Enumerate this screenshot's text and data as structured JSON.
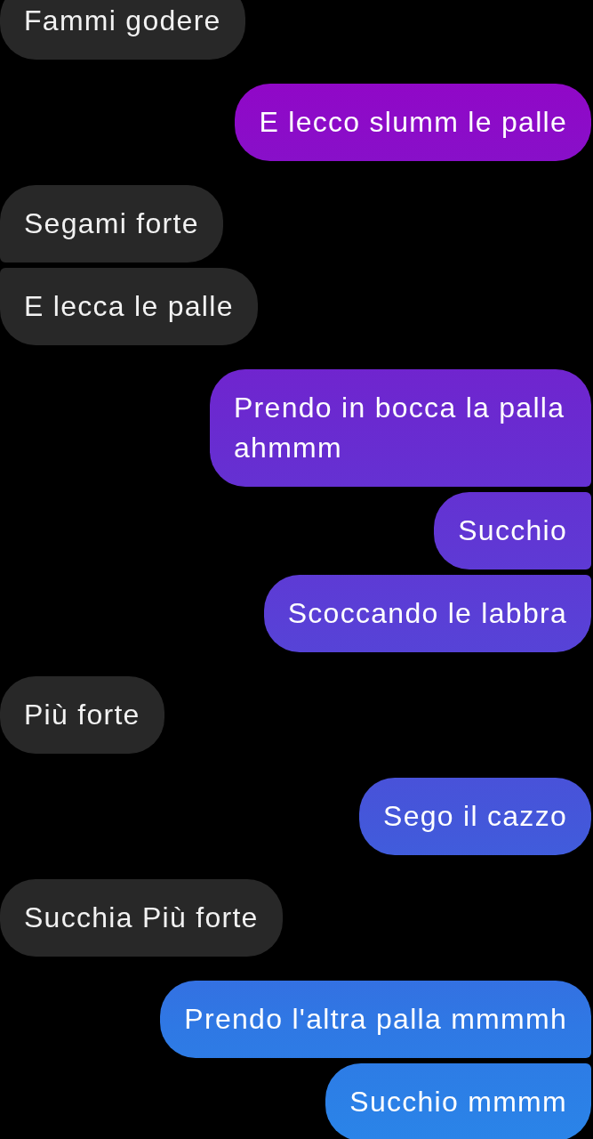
{
  "messages": [
    {
      "kind": "received",
      "text": "Fammi godere"
    },
    {
      "kind": "sent",
      "text": "E lecco slumm le palle"
    },
    {
      "kind": "received",
      "text": "Segami forte"
    },
    {
      "kind": "received",
      "text": "E lecca le palle"
    },
    {
      "kind": "sent",
      "text": "Prendo in bocca la palla ahmmm"
    },
    {
      "kind": "sent",
      "text": "Succhio"
    },
    {
      "kind": "sent",
      "text": "Scoccando le labbra"
    },
    {
      "kind": "received",
      "text": "Più forte"
    },
    {
      "kind": "sent",
      "text": "Sego il cazzo"
    },
    {
      "kind": "received",
      "text": "Succhia Più forte"
    },
    {
      "kind": "sent",
      "text": "Prendo l'altra palla mmmmh"
    },
    {
      "kind": "sent",
      "text": "Succhio mmmm"
    }
  ]
}
